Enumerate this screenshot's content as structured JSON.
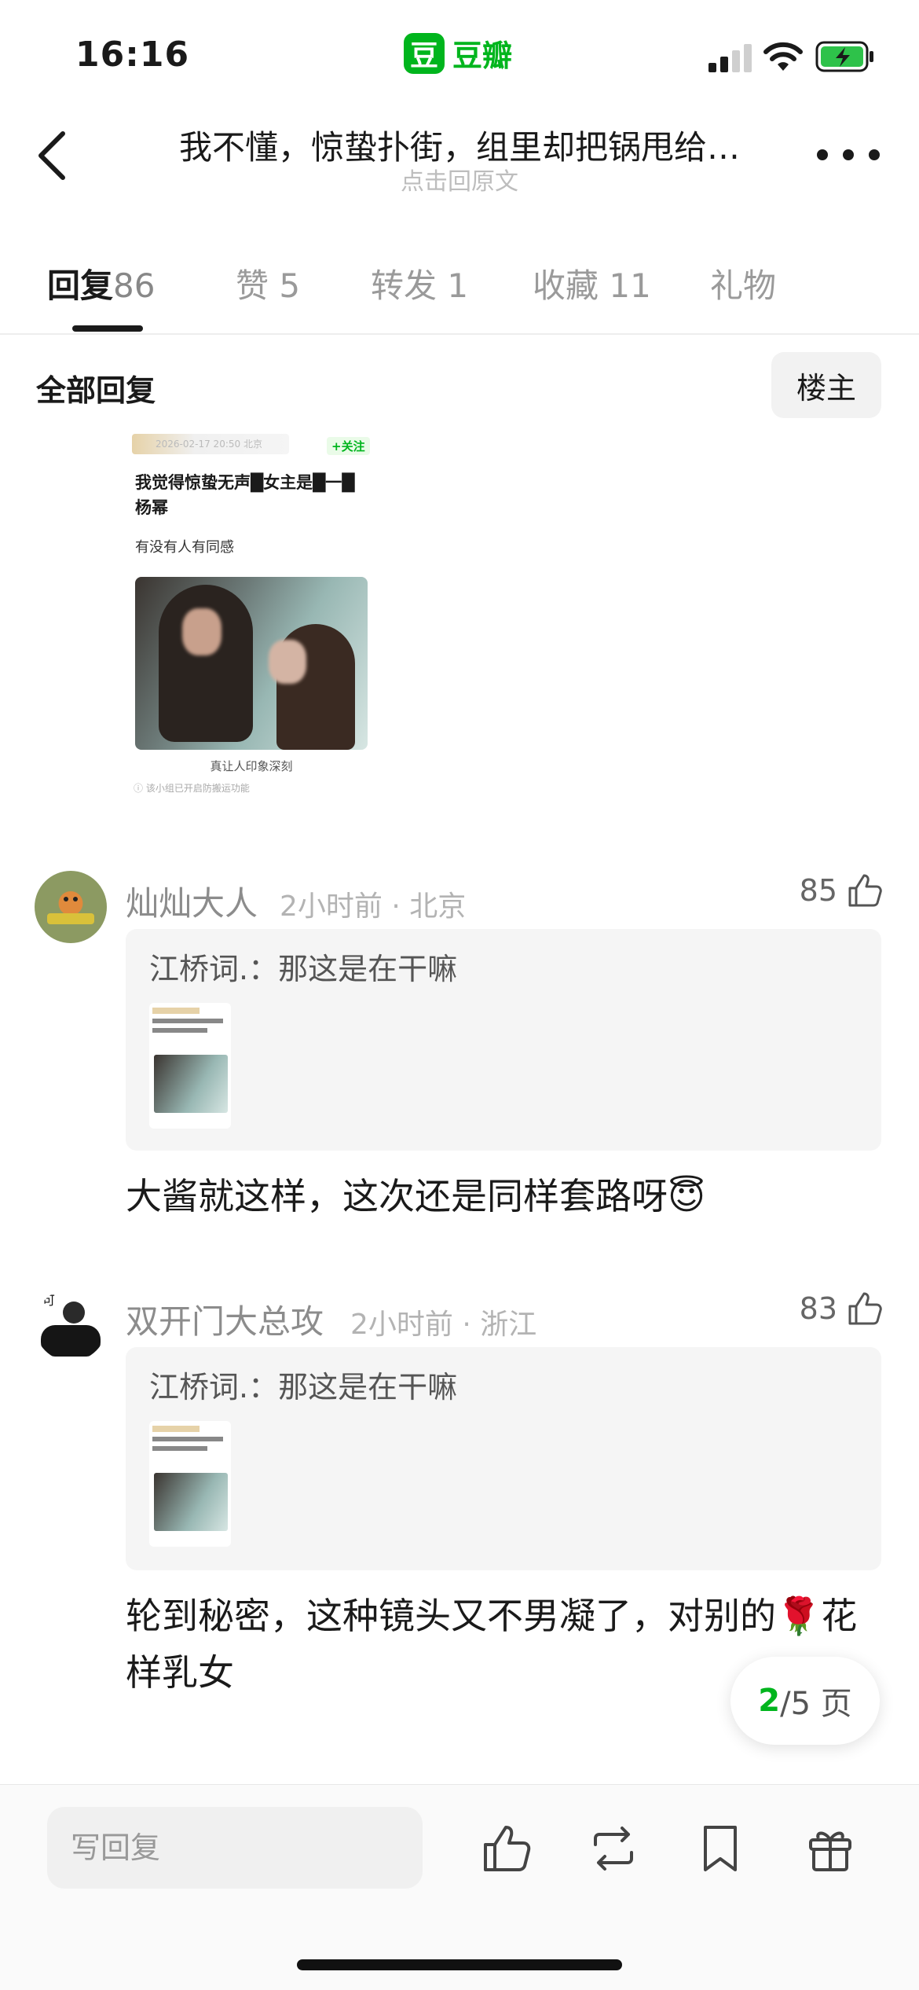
{
  "status_bar": {
    "time": "16:16",
    "app_name": "豆瓣",
    "app_logo_char": "豆"
  },
  "nav": {
    "title": "我不懂，惊蛰扑街，组里却把锅甩给…",
    "subtitle": "点击回原文"
  },
  "tabs": [
    {
      "label": "回复",
      "count": "86"
    },
    {
      "label": "赞",
      "count": "5"
    },
    {
      "label": "转发",
      "count": "1"
    },
    {
      "label": "收藏",
      "count": "11"
    },
    {
      "label": "礼物",
      "count": ""
    }
  ],
  "section": {
    "title": "全部回复",
    "owner_button": "楼主"
  },
  "post_image": {
    "meta": "2026-02-17 20:50 北京",
    "follow": "+关注",
    "title": "我觉得惊蛰无声█女主是█一█杨幂",
    "line": "有没有人有同感",
    "caption": "真让人印象深刻",
    "footer": "ⓘ 该小组已开启防搬运功能"
  },
  "comments": [
    {
      "name": "灿灿大人",
      "meta": "2小时前 · 北京",
      "likes": "85",
      "quote": "江桥词.：那这是在干嘛",
      "text": "大酱就这样，这次还是同样套路呀😇"
    },
    {
      "name": "双开门大总攻",
      "meta": "2小时前 · 浙江",
      "likes": "83",
      "quote": "江桥词.：那这是在干嘛",
      "text": "轮到秘密，这种镜头又不男凝了，对别的🌹花样乳女"
    }
  ],
  "pager": {
    "current": "2",
    "total_text": "/5 页"
  },
  "bottom_bar": {
    "reply_placeholder": "写回复"
  },
  "colors": {
    "brand_green": "#00b51d",
    "text_primary": "#1a1a1a",
    "text_secondary": "#8c8c8c"
  }
}
